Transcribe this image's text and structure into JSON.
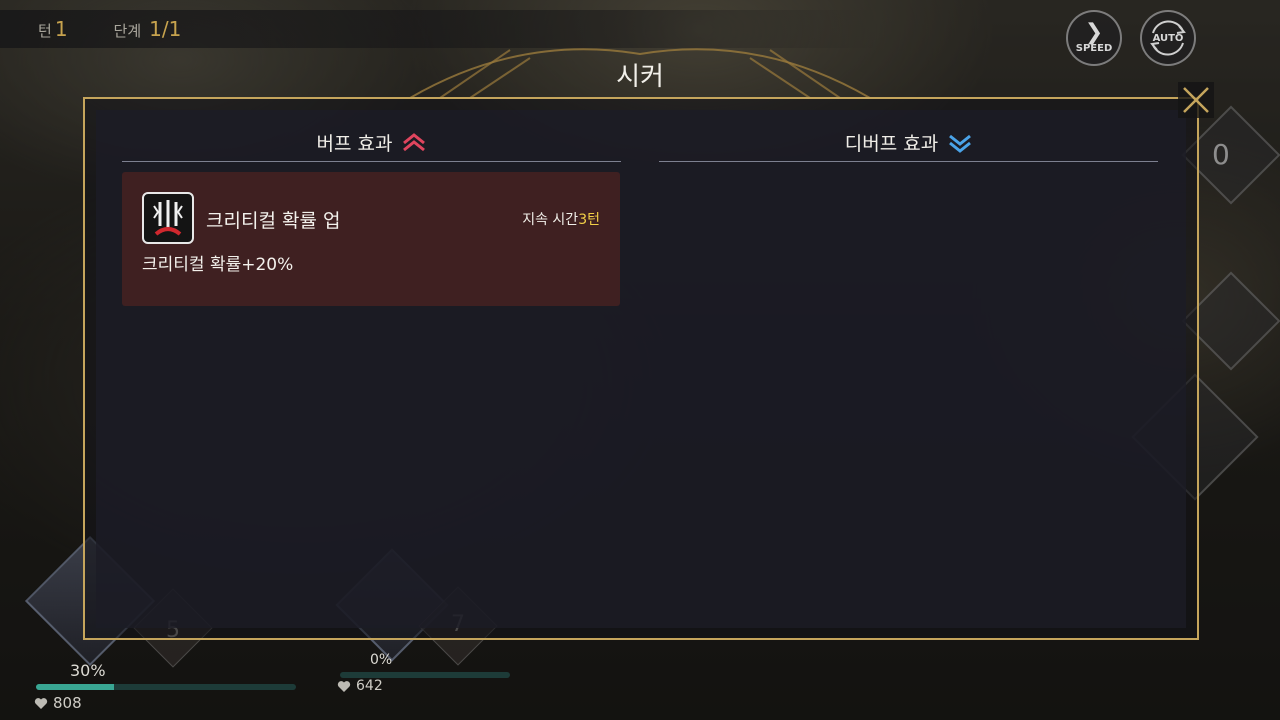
{
  "hud": {
    "turn_label": "턴",
    "turn_value": "1",
    "stage_label": "단계",
    "stage_value": "1/1",
    "speed_label": "SPEED",
    "auto_label": "AUTO",
    "side_counter": "0"
  },
  "popup": {
    "title": "시커",
    "buff_header": "버프 효과",
    "debuff_header": "디버프 효과",
    "buffs": [
      {
        "name": "크리티컬 확률 업",
        "duration_label": "지속 시간",
        "duration_value": "3턴",
        "description": "크리티컬 확률+20%",
        "icon": "triple-blade-icon"
      }
    ]
  },
  "party": [
    {
      "slot_digit": "5",
      "percent": "30%",
      "hp": "808",
      "gauge": 0.3
    },
    {
      "slot_digit": "7",
      "percent": "0%",
      "hp": "642",
      "gauge": 0.0
    }
  ],
  "colors": {
    "gold": "#c5a55c",
    "buff_card": "#3f2021",
    "buff_arrow": "#e0455e",
    "debuff_arrow": "#4aa3e8",
    "duration_highlight": "#f2cf47",
    "hp_bar": "#39a693"
  }
}
